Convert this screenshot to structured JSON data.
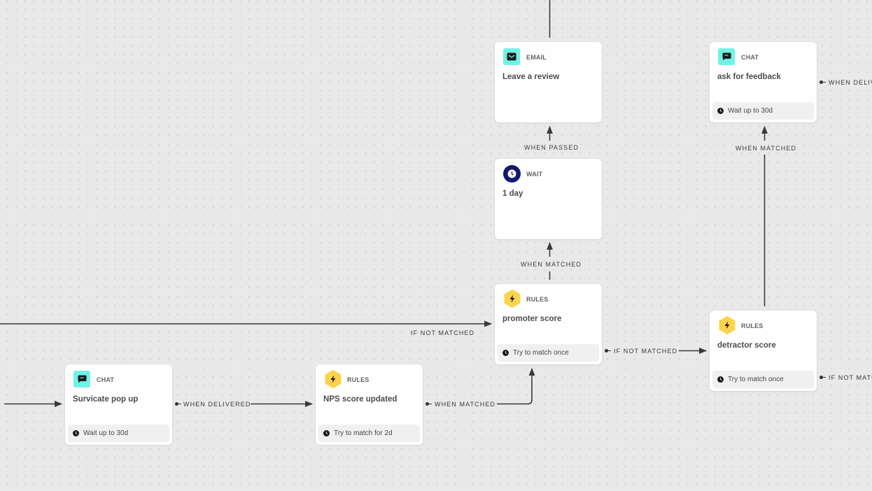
{
  "nodes": {
    "email_review": {
      "type": "EMAIL",
      "title": "Leave a review",
      "footer": null,
      "icon": "envelope-icon"
    },
    "chat_feedback": {
      "type": "CHAT",
      "title": "ask for feedback",
      "footer": "Wait up to 30d",
      "icon": "chat-bubble-icon"
    },
    "wait_1day": {
      "type": "WAIT",
      "title": "1 day",
      "footer": null,
      "icon": "clock-icon"
    },
    "rules_promoter": {
      "type": "RULES",
      "title": "promoter score",
      "footer": "Try to match once",
      "icon": "lightning-icon"
    },
    "rules_detractor": {
      "type": "RULES",
      "title": "detractor score",
      "footer": "Try to match once",
      "icon": "lightning-icon"
    },
    "chat_survicate": {
      "type": "CHAT",
      "title": "Survicate pop up",
      "footer": "Wait up to 30d",
      "icon": "chat-bubble-icon"
    },
    "rules_nps": {
      "type": "RULES",
      "title": "NPS score updated",
      "footer": "Try to match for 2d",
      "icon": "lightning-icon"
    }
  },
  "edge_labels": {
    "when_passed": "WHEN PASSED",
    "when_matched_wait": "WHEN MATCHED",
    "when_matched_feedback": "WHEN MATCHED",
    "if_not_matched_left": "IF NOT MATCHED",
    "if_not_matched_promoter": "IF NOT MATCHED",
    "when_delivered_survicate": "WHEN DELIVERED",
    "when_matched_nps": "WHEN MATCHED",
    "when_delivered_feedback": "WHEN DELIV",
    "if_not_matched_detractor": "IF NOT MATC"
  },
  "colors": {
    "chat_icon_bg": "#6ff3e6",
    "email_icon_bg": "#6ff3e6",
    "wait_icon_bg": "#131a6b",
    "rules_icon_bg": "#fbd34d",
    "edge": "#3a3a3a",
    "canvas_bg": "#e9e9e9"
  }
}
